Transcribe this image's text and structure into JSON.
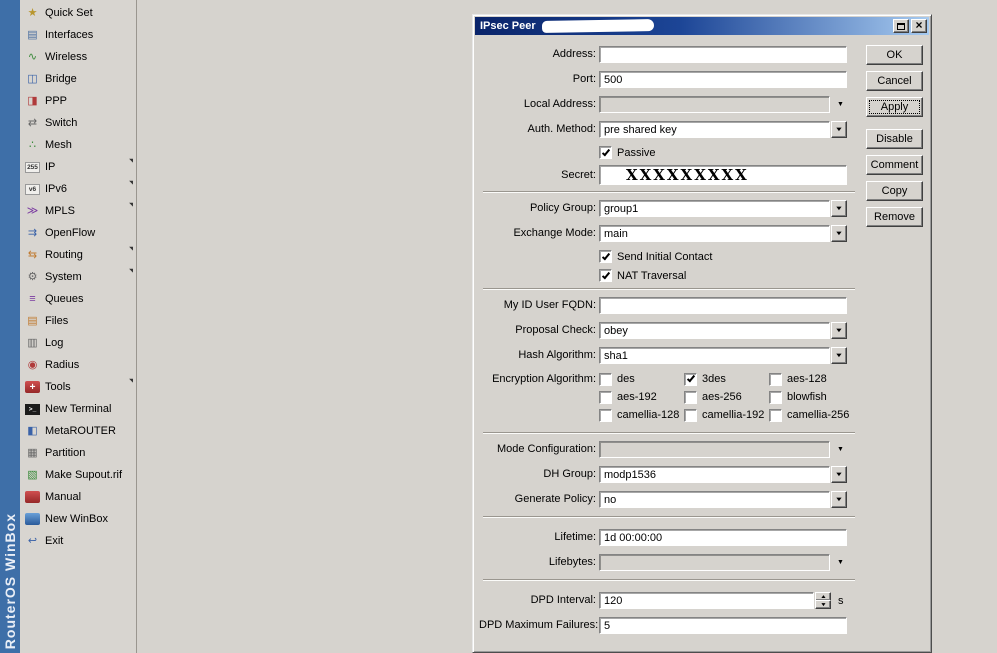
{
  "branding": {
    "vertical_text": "RouterOS WinBox"
  },
  "glyphs": {
    "dropdown": "▼",
    "spin_up": "▲",
    "spin_down": "▼",
    "submenu_arrow": "◥",
    "close": "×"
  },
  "sidebar": {
    "items": [
      {
        "name": "sidebar-item-quick-set",
        "icon": "wand-icon",
        "glyph": "★",
        "cls": "ic-gold",
        "label": "Quick Set",
        "has_arrow": false
      },
      {
        "name": "sidebar-item-interfaces",
        "icon": "interfaces-icon",
        "glyph": "▤",
        "cls": "ic-steel",
        "label": "Interfaces",
        "has_arrow": false
      },
      {
        "name": "sidebar-item-wireless",
        "icon": "antenna-icon",
        "glyph": "∿",
        "cls": "ic-green",
        "label": "Wireless",
        "has_arrow": false
      },
      {
        "name": "sidebar-item-bridge",
        "icon": "bridge-icon",
        "glyph": "◫",
        "cls": "ic-blue",
        "label": "Bridge",
        "has_arrow": false
      },
      {
        "name": "sidebar-item-ppp",
        "icon": "ppp-icon",
        "glyph": "◨",
        "cls": "ic-red",
        "label": "PPP",
        "has_arrow": false
      },
      {
        "name": "sidebar-item-switch",
        "icon": "switch-icon",
        "glyph": "⇄",
        "cls": "ic-gray",
        "label": "Switch",
        "has_arrow": false
      },
      {
        "name": "sidebar-item-mesh",
        "icon": "mesh-icon",
        "glyph": "∴",
        "cls": "ic-green",
        "label": "Mesh",
        "has_arrow": false
      },
      {
        "name": "sidebar-item-ip",
        "icon": "ip-icon",
        "glyph": "255",
        "cls": "ic-tiny",
        "label": "IP",
        "has_arrow": true
      },
      {
        "name": "sidebar-item-ipv6",
        "icon": "ipv6-icon",
        "glyph": "v6",
        "cls": "ic-tiny",
        "label": "IPv6",
        "has_arrow": true
      },
      {
        "name": "sidebar-item-mpls",
        "icon": "mpls-icon",
        "glyph": "≫",
        "cls": "ic-purple",
        "label": "MPLS",
        "has_arrow": true
      },
      {
        "name": "sidebar-item-openflow",
        "icon": "openflow-icon",
        "glyph": "⇉",
        "cls": "ic-blue",
        "label": "OpenFlow",
        "has_arrow": false
      },
      {
        "name": "sidebar-item-routing",
        "icon": "routing-icon",
        "glyph": "⇆",
        "cls": "ic-orange",
        "label": "Routing",
        "has_arrow": true
      },
      {
        "name": "sidebar-item-system",
        "icon": "gear-icon",
        "glyph": "⚙",
        "cls": "ic-gray",
        "label": "System",
        "has_arrow": true
      },
      {
        "name": "sidebar-item-queues",
        "icon": "queues-icon",
        "glyph": "≡",
        "cls": "ic-purple",
        "label": "Queues",
        "has_arrow": false
      },
      {
        "name": "sidebar-item-files",
        "icon": "folder-icon",
        "glyph": "▤",
        "cls": "ic-orange",
        "label": "Files",
        "has_arrow": false
      },
      {
        "name": "sidebar-item-log",
        "icon": "log-icon",
        "glyph": "▥",
        "cls": "ic-gray",
        "label": "Log",
        "has_arrow": false
      },
      {
        "name": "sidebar-item-radius",
        "icon": "radius-icon",
        "glyph": "◉",
        "cls": "ic-red",
        "label": "Radius",
        "has_arrow": false
      },
      {
        "name": "sidebar-item-tools",
        "icon": "toolbox-icon",
        "glyph": "+",
        "cls": "ic-box-red",
        "label": "Tools",
        "has_arrow": true
      },
      {
        "name": "sidebar-item-new-terminal",
        "icon": "terminal-icon",
        "glyph": ">_",
        "cls": "ic-term",
        "label": "New Terminal",
        "has_arrow": false
      },
      {
        "name": "sidebar-item-metarouter",
        "icon": "metarouter-icon",
        "glyph": "◧",
        "cls": "ic-blue",
        "label": "MetaROUTER",
        "has_arrow": false
      },
      {
        "name": "sidebar-item-partition",
        "icon": "partition-icon",
        "glyph": "▦",
        "cls": "ic-gray",
        "label": "Partition",
        "has_arrow": false
      },
      {
        "name": "sidebar-item-make-supout",
        "icon": "supout-file-icon",
        "glyph": "▧",
        "cls": "ic-green",
        "label": "Make Supout.rif",
        "has_arrow": false
      },
      {
        "name": "sidebar-item-manual",
        "icon": "manual-book-icon",
        "glyph": "",
        "cls": "ic-box-red",
        "label": "Manual",
        "has_arrow": false
      },
      {
        "name": "sidebar-item-new-winbox",
        "icon": "winbox-icon",
        "glyph": "",
        "cls": "ic-box-blue",
        "label": "New WinBox",
        "has_arrow": false
      },
      {
        "name": "sidebar-item-exit",
        "icon": "exit-door-icon",
        "glyph": "↩",
        "cls": "ic-blue",
        "label": "Exit",
        "has_arrow": false
      }
    ]
  },
  "dialog": {
    "title": "IPsec Peer",
    "titlebar": {
      "close_glyph": "×"
    },
    "action_buttons": [
      {
        "label": "OK",
        "name": "ok-button"
      },
      {
        "label": "Cancel",
        "name": "cancel-button"
      },
      {
        "label": "Apply",
        "name": "apply-button",
        "extra_cls": "focused gap-after"
      },
      {
        "label": "Disable",
        "name": "disable-button"
      },
      {
        "label": "Comment",
        "name": "comment-button"
      },
      {
        "label": "Copy",
        "name": "copy-button"
      },
      {
        "label": "Remove",
        "name": "remove-button"
      }
    ],
    "fields": {
      "address": {
        "label": "Address:",
        "value": ""
      },
      "port": {
        "label": "Port:",
        "value": "500"
      },
      "local_address": {
        "label": "Local Address:",
        "value": ""
      },
      "auth_method": {
        "label": "Auth. Method:",
        "value": "pre shared key"
      },
      "passive": {
        "label": "Passive",
        "checked": true
      },
      "secret": {
        "label": "Secret:",
        "value": "XXXXXXXXX"
      },
      "policy_group": {
        "label": "Policy Group:",
        "value": "group1"
      },
      "exchange_mode": {
        "label": "Exchange Mode:",
        "value": "main"
      },
      "send_initial_contact": {
        "label": "Send Initial Contact",
        "checked": true
      },
      "nat_traversal": {
        "label": "NAT Traversal",
        "checked": true
      },
      "my_id_user_fqdn": {
        "label": "My ID User FQDN:",
        "value": ""
      },
      "proposal_check": {
        "label": "Proposal Check:",
        "value": "obey"
      },
      "hash_algorithm": {
        "label": "Hash Algorithm:",
        "value": "sha1"
      },
      "encryption_algorithm": {
        "label": "Encryption Algorithm:",
        "options": [
          {
            "name": "encryption-des-checkbox",
            "label": "des",
            "checked": false
          },
          {
            "name": "encryption-3des-checkbox",
            "label": "3des",
            "checked": true
          },
          {
            "name": "encryption-aes-128-checkbox",
            "label": "aes-128",
            "checked": false
          },
          {
            "name": "encryption-aes-192-checkbox",
            "label": "aes-192",
            "checked": false
          },
          {
            "name": "encryption-aes-256-checkbox",
            "label": "aes-256",
            "checked": false
          },
          {
            "name": "encryption-blowfish-checkbox",
            "label": "blowfish",
            "checked": false
          },
          {
            "name": "encryption-camellia-128-checkbox",
            "label": "camellia-128",
            "checked": false
          },
          {
            "name": "encryption-camellia-192-checkbox",
            "label": "camellia-192",
            "checked": false
          },
          {
            "name": "encryption-camellia-256-checkbox",
            "label": "camellia-256",
            "checked": false
          }
        ]
      },
      "mode_configuration": {
        "label": "Mode Configuration:",
        "value": ""
      },
      "dh_group": {
        "label": "DH Group:",
        "value": "modp1536"
      },
      "generate_policy": {
        "label": "Generate Policy:",
        "value": "no"
      },
      "lifetime": {
        "label": "Lifetime:",
        "value": "1d 00:00:00"
      },
      "lifebytes": {
        "label": "Lifebytes:",
        "value": ""
      },
      "dpd_interval": {
        "label": "DPD Interval:",
        "value": "120",
        "suffix": "s"
      },
      "dpd_maximum_failures": {
        "label": "DPD Maximum Failures:",
        "value": "5"
      }
    }
  }
}
